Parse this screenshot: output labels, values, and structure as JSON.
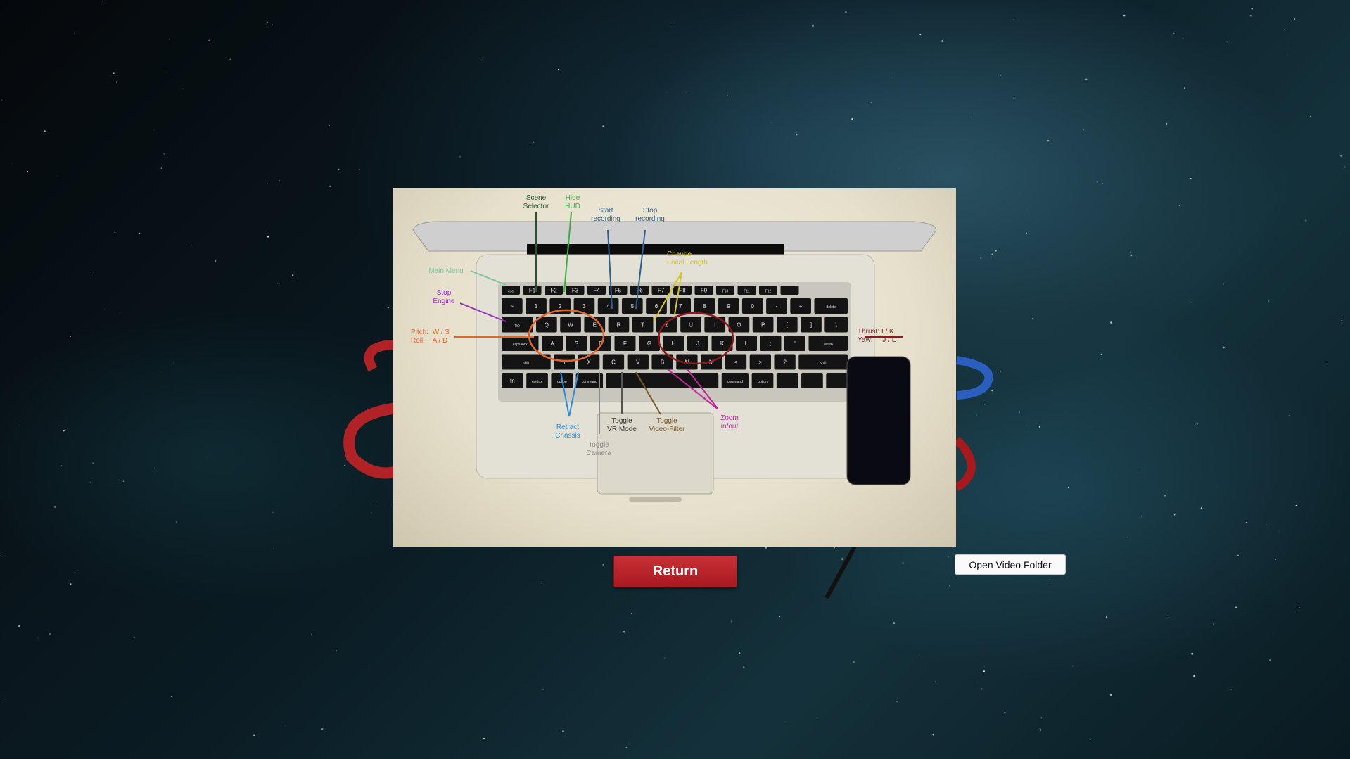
{
  "colors": {
    "return_bg": "#b72228",
    "scene_selector": "#1d5a2d",
    "hide_hud": "#3fae49",
    "recording": "#2f5f8e",
    "focal_length": "#d7c52a",
    "main_menu": "#7fc3a4",
    "stop_engine": "#9a2fb8",
    "pitch_roll": "#e0662a",
    "thrust_yaw": "#8b1a1a",
    "retract_chassis": "#2a8fd6",
    "toggle_camera": "#8a8a8a",
    "toggle_vr": "#555555",
    "toggle_video_filter": "#7a5a2a",
    "zoom": "#c0289a"
  },
  "help_image": {
    "labels": {
      "scene_selector": [
        "Scene",
        "Selector"
      ],
      "hide_hud": [
        "Hide",
        "HUD"
      ],
      "start_recording": [
        "Start",
        "recording"
      ],
      "stop_recording": [
        "Stop",
        "recording"
      ],
      "change_focal_length": [
        "Change",
        "Focal Length"
      ],
      "main_menu": "Main Menu",
      "stop_engine": [
        "Stop",
        "Engine"
      ],
      "pitch": "Pitch:  W / S",
      "roll": "Roll:    A / D",
      "thrust": "Thrust: I / K",
      "yaw": "Yaw:     J / L",
      "retract_chassis": [
        "Retract",
        "Chassis"
      ],
      "toggle_camera": [
        "Toggle",
        "Camera"
      ],
      "toggle_vr_mode": [
        "Toggle",
        "VR Mode"
      ],
      "toggle_video_filter": [
        "Toggle",
        "Video-Filter"
      ],
      "zoom": [
        "Zoom",
        "in/out"
      ]
    },
    "keyboard_rows": [
      [
        "~",
        "1",
        "2",
        "3",
        "4",
        "5",
        "6",
        "7",
        "8",
        "9",
        "0",
        "-",
        "+",
        "delete"
      ],
      [
        "tab",
        "Q",
        "W",
        "E",
        "R",
        "T",
        "Z",
        "U",
        "I",
        "O",
        "P",
        "[",
        "]",
        "\\"
      ],
      [
        "caps lock",
        "A",
        "S",
        "D",
        "F",
        "G",
        "H",
        "J",
        "K",
        "L",
        ";",
        "'",
        "return"
      ],
      [
        "shift",
        "Y",
        "X",
        "C",
        "V",
        "B",
        "N",
        "M",
        "<",
        ">",
        "?",
        "shift"
      ],
      [
        "fn",
        "control",
        "option",
        "command",
        "",
        "command",
        "option",
        "",
        "",
        ""
      ]
    ],
    "function_row": [
      "esc",
      "F1",
      "F2",
      "F3",
      "F4",
      "F5",
      "F6",
      "F7",
      "F8",
      "F9",
      "F10",
      "F11",
      "F12",
      ""
    ]
  },
  "buttons": {
    "return_label": "Return",
    "open_video_folder_label": "Open Video Folder"
  }
}
